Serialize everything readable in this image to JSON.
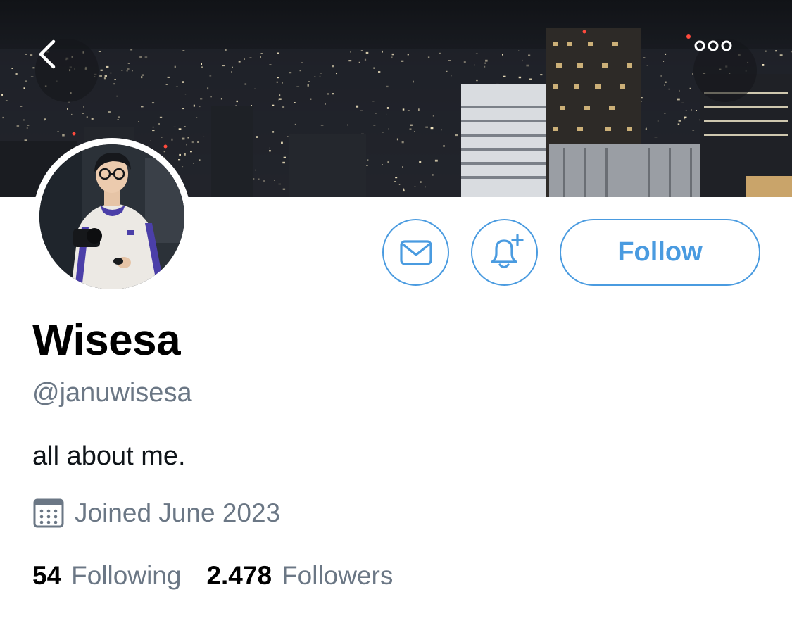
{
  "profile": {
    "display_name": "Wisesa",
    "handle": "@januwisesa",
    "bio": "all about me.",
    "joined": "Joined June 2023"
  },
  "stats": {
    "following_count": "54",
    "following_label": "Following",
    "followers_count": "2.478",
    "followers_label": "Followers"
  },
  "actions": {
    "follow_label": "Follow"
  },
  "icons": {
    "back": "chevron-left-icon",
    "more": "more-icon",
    "message": "envelope-icon",
    "notify": "bell-plus-icon",
    "calendar": "calendar-icon"
  },
  "colors": {
    "accent": "#4a9be0",
    "secondary_text": "#6b7785",
    "primary_text": "#000000"
  }
}
